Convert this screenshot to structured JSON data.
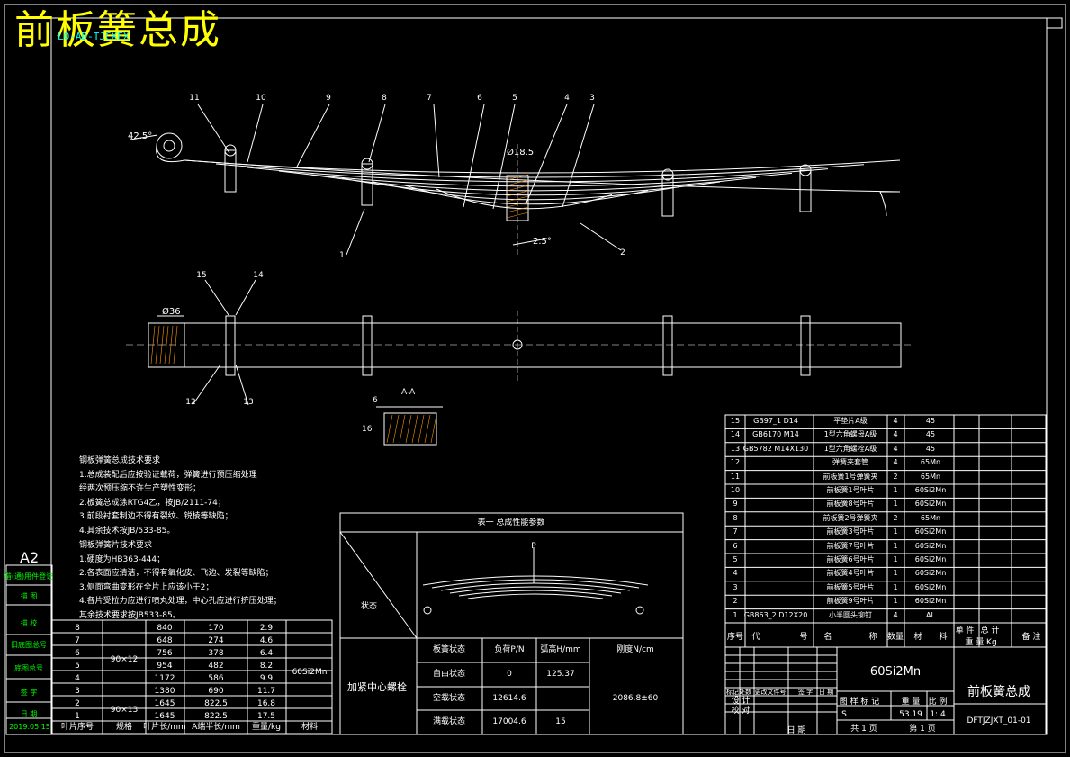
{
  "title": "前板簧总成",
  "drawing_id": "LO-AD-TJCXFX",
  "sheet_size": "A2",
  "date": "2019.05.15",
  "dims": {
    "angle_top": "42.5°",
    "hole_dia": "Ø18.5",
    "angle_center": "2.5°",
    "dia_36": "Ø36",
    "section_label": "A-A",
    "sec_6": "6",
    "sec_16": "16"
  },
  "balloons": {
    "side_top": [
      "11",
      "10",
      "9",
      "8",
      "7",
      "6",
      "5",
      "4",
      "3"
    ],
    "side_bottom": [
      "1",
      "2"
    ],
    "plan_top": [
      "15",
      "14"
    ],
    "plan_bottom": [
      "12",
      "13"
    ]
  },
  "notes1": {
    "heading": "钢板弹簧总成技术要求",
    "lines": [
      "1.总成装配后应按验证载荷，弹簧进行预压缩处理",
      "  经两次预压缩不许生产塑性变形；",
      "2.板簧总成涂RTG4乙，按JB/2111-74；",
      "3.前段衬套制边不得有裂纹、锐棱等缺陷；",
      "4.其余技术按JB/533-85。"
    ]
  },
  "notes2": {
    "heading": "钢板弹簧片技术要求",
    "lines": [
      "1.硬度为HB363-444；",
      "2.各表面应清洁，不得有氧化皮、飞边、发裂等缺陷；",
      "3.侧面弯曲变形在全片上应该小于2；",
      "4.各片受拉力应进行喷丸处理，中心孔应进行挤压处理；",
      "  其余技术要求按JB533-85。"
    ]
  },
  "left_strip": [
    "借(通)用件登记",
    "描 图",
    "描 校",
    "旧底图总号",
    "底图总号",
    "签 字",
    "日 期"
  ],
  "leaf_table": {
    "headers": [
      "叶片序号",
      "规格",
      "叶片长/mm",
      "A端半长/mm",
      "重量/kg",
      "材料"
    ],
    "rows": [
      [
        "8",
        "840",
        "170",
        "2.9"
      ],
      [
        "7",
        "648",
        "274",
        "4.6"
      ],
      [
        "6",
        "756",
        "378",
        "6.4"
      ],
      [
        "5",
        "954",
        "482",
        "8.2"
      ],
      [
        "4",
        "1172",
        "586",
        "9.9"
      ],
      [
        "3",
        "1380",
        "690",
        "11.7"
      ],
      [
        "2",
        "1645",
        "822.5",
        "16.8"
      ],
      [
        "1",
        "1645",
        "822.5",
        "17.5"
      ]
    ],
    "spec_a": "90×12",
    "spec_b": "90×13",
    "material": "60Si2Mn"
  },
  "perf_table": {
    "caption": "表一 总成性能参数",
    "state_label": "状态",
    "load_label": "P",
    "bolt_label": "加紧中心螺栓",
    "headers": [
      "板簧状态",
      "负荷P/N",
      "弧高H/mm",
      "刚度N/cm"
    ],
    "rows": [
      [
        "自由状态",
        "0",
        "125.37"
      ],
      [
        "空载状态",
        "12614.6",
        ""
      ],
      [
        "满载状态",
        "17004.6",
        "15"
      ]
    ],
    "stiffness": "2086.8±60"
  },
  "bom": {
    "rows": [
      [
        "15",
        "GB97_1 D14",
        "平垫片A级",
        "4",
        "45"
      ],
      [
        "14",
        "GB6170 M14",
        "1型六角螺母A级",
        "4",
        "45"
      ],
      [
        "13",
        "GB5782 M14X130",
        "1型六角螺栓A级",
        "4",
        "45"
      ],
      [
        "12",
        "",
        "弹簧夹套管",
        "4",
        "65Mn"
      ],
      [
        "11",
        "",
        "前板簧1号弹簧夹",
        "2",
        "65Mn"
      ],
      [
        "10",
        "",
        "前板簧1号叶片",
        "1",
        "60Si2Mn"
      ],
      [
        "9",
        "",
        "前板簧8号叶片",
        "1",
        "60Si2Mn"
      ],
      [
        "8",
        "",
        "前板簧2号弹簧夹",
        "2",
        "65Mn"
      ],
      [
        "7",
        "",
        "前板簧3号叶片",
        "1",
        "60Si2Mn"
      ],
      [
        "6",
        "",
        "前板簧7号叶片",
        "1",
        "60Si2Mn"
      ],
      [
        "5",
        "",
        "前板簧6号叶片",
        "1",
        "60Si2Mn"
      ],
      [
        "4",
        "",
        "前板簧4号叶片",
        "1",
        "60Si2Mn"
      ],
      [
        "3",
        "",
        "前板簧5号叶片",
        "1",
        "60Si2Mn"
      ],
      [
        "2",
        "",
        "前板簧9号叶片",
        "1",
        "60Si2Mn"
      ],
      [
        "1",
        "GB863_2 D12X20",
        "小半圆头铆钉",
        "4",
        "AL"
      ]
    ],
    "header": [
      "序号",
      "代",
      "号",
      "名",
      "称",
      "数量",
      "材",
      "料",
      "单 件",
      "总 计",
      "重 量 Kg",
      "备 注"
    ]
  },
  "title_block": {
    "material": "60Si2Mn",
    "name": "前板簧总成",
    "code": "DFTJZJXT_01-01",
    "rev_headers": [
      "标记",
      "处数",
      "更改文件号",
      "签 字",
      "日 期"
    ],
    "design": "设 计",
    "check": "校 对",
    "date_label": "日 期",
    "stage_label": "图 样 标 记",
    "weight_label": "重 量",
    "scale_label": "比 例",
    "stage": "S",
    "weight": "53.19",
    "scale": "1: 4",
    "total_sheets": "共 1 页",
    "sheet_no": "第 1 页"
  }
}
